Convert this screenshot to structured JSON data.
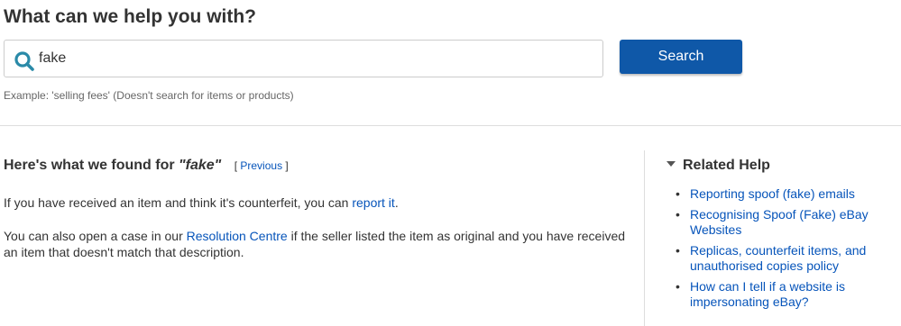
{
  "page": {
    "title": "What can we help you with?"
  },
  "search": {
    "value": "fake",
    "button_label": "Search",
    "hint": "Example: 'selling fees' (Doesn't search for items or products)"
  },
  "results": {
    "heading_prefix": "Here's what we found for ",
    "query": "\"fake\"",
    "previous_open": "[ ",
    "previous_label": "Previous",
    "previous_close": " ]",
    "para1_text": "If you have received an item and think it's counterfeit, you can ",
    "para1_link": "report it",
    "para1_end": ".",
    "para2_text_a": "You can also open a case in our ",
    "para2_link": "Resolution Centre",
    "para2_text_b": " if the seller listed the item as original and you have received an item that doesn't match that description."
  },
  "related": {
    "heading": "Related Help",
    "items": [
      {
        "label": "Reporting spoof (fake) emails"
      },
      {
        "label": "Recognising Spoof (Fake) eBay Websites"
      },
      {
        "label": "Replicas, counterfeit items, and unauthorised copies policy"
      },
      {
        "label": "How can I tell if a website is impersonating eBay?"
      }
    ]
  },
  "colors": {
    "primary_button": "#0f58a8",
    "link": "#0654ba",
    "text": "#333333",
    "icon_accent": "#2a8aa8"
  }
}
